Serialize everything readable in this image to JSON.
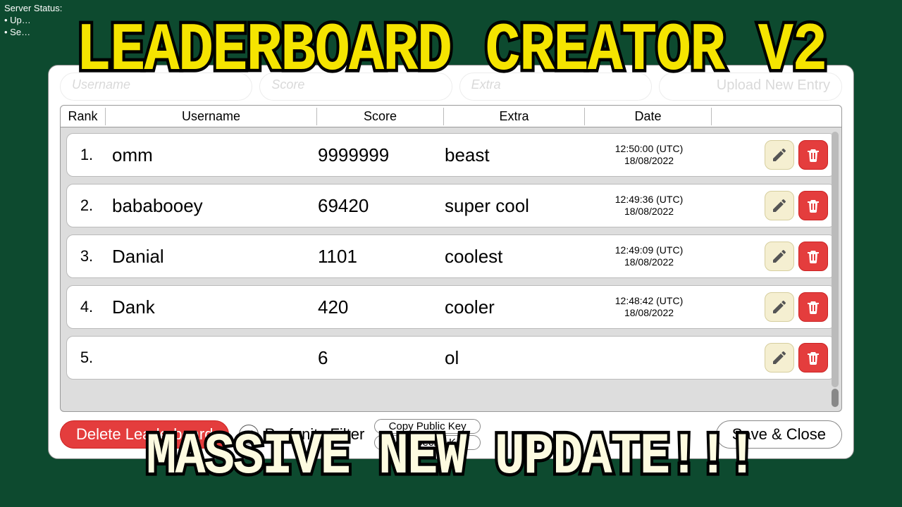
{
  "status": {
    "header": "Server Status:",
    "lines": [
      "Up…",
      "Se…"
    ]
  },
  "overlay": {
    "title": "LEADERBOARD CREATOR V2",
    "subtitle": "MASSIVE NEW UPDATE!!!"
  },
  "inputs": {
    "username_ph": "Username",
    "score_ph": "Score",
    "extra_ph": "Extra",
    "upload_label": "Upload New Entry"
  },
  "columns": {
    "rank": "Rank",
    "username": "Username",
    "score": "Score",
    "extra": "Extra",
    "date": "Date"
  },
  "rows": [
    {
      "rank": "1.",
      "username": "omm",
      "score": "9999999",
      "extra": "beast",
      "time": "12:50:00 (UTC)",
      "day": "18/08/2022"
    },
    {
      "rank": "2.",
      "username": "bababooey",
      "score": "69420",
      "extra": "super cool",
      "time": "12:49:36 (UTC)",
      "day": "18/08/2022"
    },
    {
      "rank": "3.",
      "username": "Danial",
      "score": "1101",
      "extra": "coolest",
      "time": "12:49:09 (UTC)",
      "day": "18/08/2022"
    },
    {
      "rank": "4.",
      "username": "Dank",
      "score": "420",
      "extra": "cooler",
      "time": "12:48:42 (UTC)",
      "day": "18/08/2022"
    },
    {
      "rank": "5.",
      "username": "",
      "score": "6",
      "extra": "ol",
      "time": "",
      "day": ""
    }
  ],
  "footer": {
    "delete": "Delete Leaderboard",
    "profanity": "Profanity Filter",
    "copy_public": "Copy Public Key",
    "copy_secret": "Copy Secret Key",
    "save": "Save & Close"
  },
  "checkmark": "✓"
}
